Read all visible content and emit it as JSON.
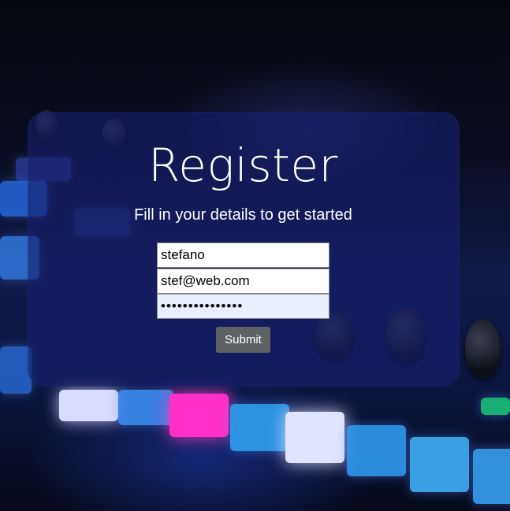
{
  "form": {
    "title": "Register",
    "subtitle": "Fill in your details to get started",
    "name_value": "stefano",
    "email_value": "stef@web.com",
    "password_value": "•••••••••••••••",
    "submit_label": "Submit"
  },
  "colors": {
    "card_background": "#1a2470",
    "submit_background": "#5f6265",
    "autofill_background": "#e8f0fe"
  }
}
